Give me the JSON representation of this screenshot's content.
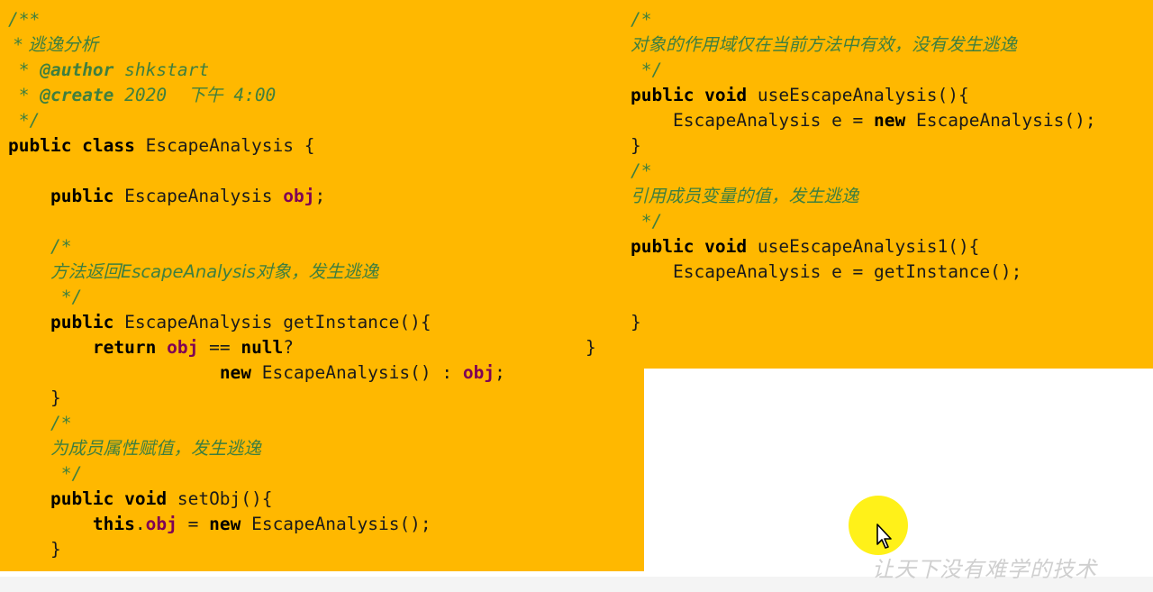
{
  "left_code": {
    "doc_open": "/**",
    "doc_title": " * 逃逸分析",
    "doc_author_prefix": " * ",
    "doc_author_tag": "@author",
    "doc_author_value": " shkstart",
    "doc_create_prefix": " * ",
    "doc_create_tag": "@create",
    "doc_create_value": " 2020  下午 4:00",
    "doc_close": " */",
    "class_kw": "public class",
    "class_rest": " EscapeAnalysis {",
    "field_kw": "public",
    "field_type": " EscapeAnalysis ",
    "field_name": "obj",
    "field_end": ";",
    "c1_open": "/*",
    "c1_text": "方法返回EscapeAnalysis对象，发生逃逸",
    "c1_close": " */",
    "m1_kw": "public",
    "m1_rest": " EscapeAnalysis getInstance(){",
    "ret_kw": "return",
    "ret_field": "obj",
    "ret_mid": " == ",
    "ret_null": "null",
    "ret_q": "?",
    "new_kw": "new",
    "new_mid": " EscapeAnalysis() : ",
    "new_field": "obj",
    "new_end": ";",
    "m1_close": "}",
    "c2_open": "/*",
    "c2_text": "为成员属性赋值，发生逃逸",
    "c2_close": " */",
    "m2_kw": "public void",
    "m2_rest": " setObj(){",
    "this_kw": "this",
    "this_dot": ".",
    "this_field": "obj",
    "this_eq": " = ",
    "this_new": "new",
    "this_rest": " EscapeAnalysis();",
    "m2_close": "}",
    "stray_brace": "}"
  },
  "right_code": {
    "c3_open": "/*",
    "c3_text": "对象的作用域仅在当前方法中有效，没有发生逃逸",
    "c3_close": " */",
    "m3_kw": "public void",
    "m3_rest": " useEscapeAnalysis(){",
    "m3_body_pre": "EscapeAnalysis e = ",
    "m3_body_new": "new",
    "m3_body_rest": " EscapeAnalysis();",
    "m3_close": "}",
    "c4_open": "/*",
    "c4_text": "引用成员变量的值，发生逃逸",
    "c4_close": " */",
    "m4_kw": "public void",
    "m4_rest": " useEscapeAnalysis1(){",
    "m4_body": "EscapeAnalysis e = getInstance();",
    "m4_close": "}"
  },
  "watermark": "让天下没有难学的技术",
  "colors": {
    "background": "#ffb800",
    "comment": "#3f7f3f",
    "field": "#7f0055",
    "keyword": "#000000",
    "cursor_highlight": "#fff000"
  },
  "icons": {
    "cursor": "mouse-pointer-icon"
  }
}
